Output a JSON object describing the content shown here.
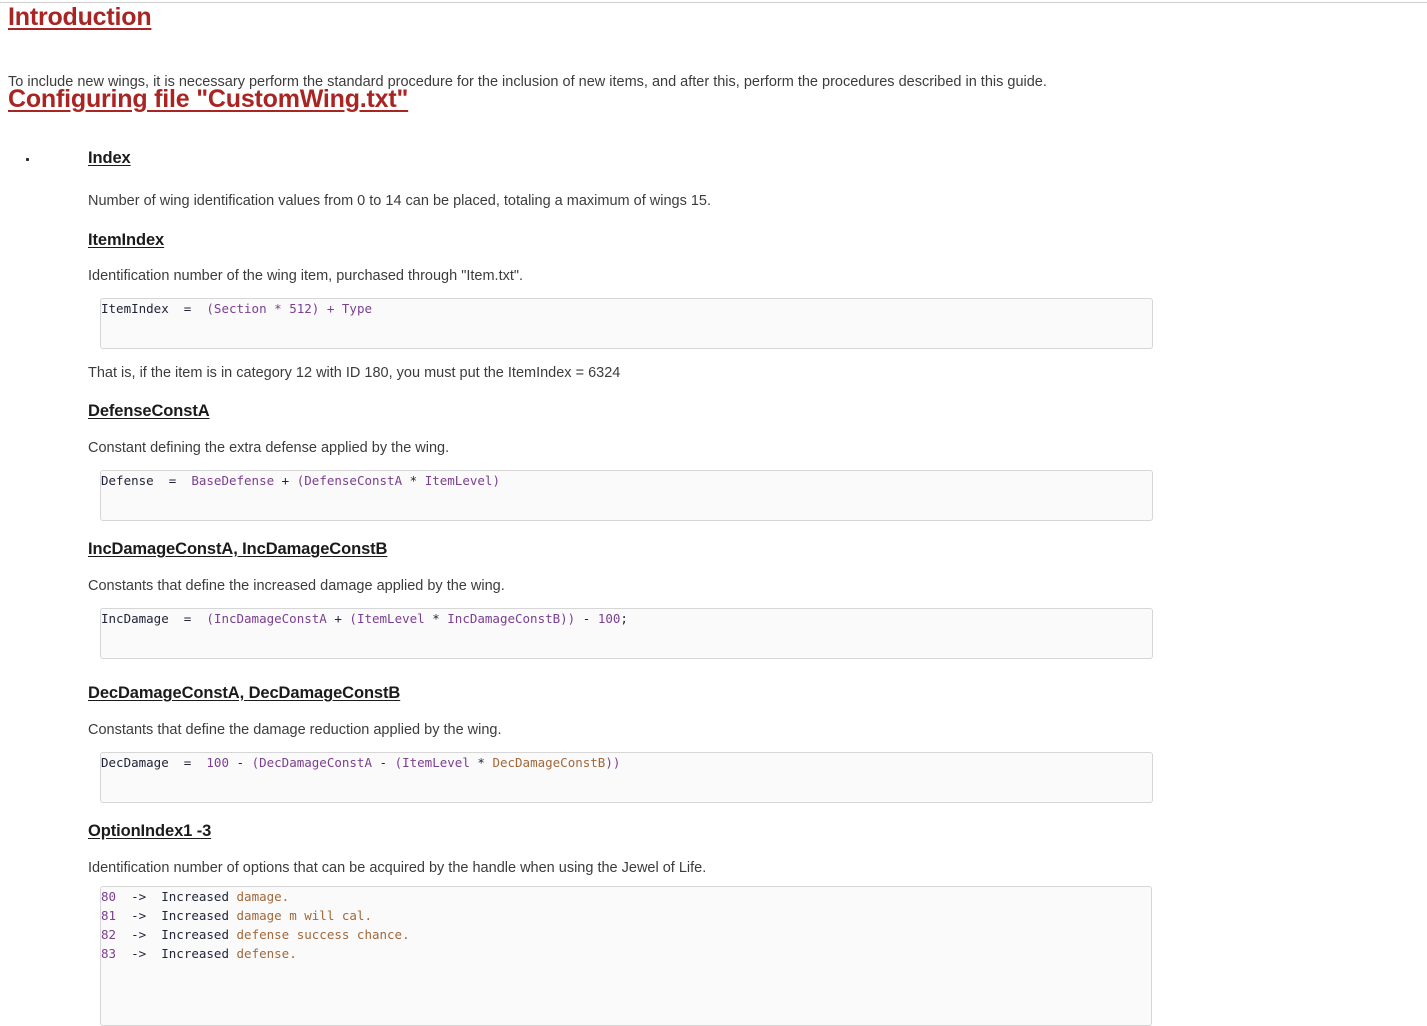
{
  "document": {
    "title_1": "Introduction",
    "intro_paragraph": "To include new wings, it is necessary perform the standard procedure for the inclusion of new items, and after this, perform the procedures described in this guide.",
    "title_2": "Configuring file \"CustomWing.txt\""
  },
  "sections": [
    {
      "heading": "Index",
      "description": "Number of wing identification values from 0 to 14 can be placed, totaling a maximum of wings 15."
    },
    {
      "heading": "ItemIndex",
      "description": "Identification number of the wing item, purchased through \"Item.txt\".",
      "code": {
        "lhs": "ItemIndex",
        "eq": "=",
        "open": "(",
        "arg1": "Section",
        "mul": "*",
        "num": "512",
        "close": ")",
        "plus": "+",
        "arg2": "Type"
      },
      "note": "That is, if the item is in category 12 with ID 180, you must put the ItemIndex = 6324"
    },
    {
      "heading": "DefenseConstA",
      "description": "Constant defining the extra defense applied by the wing.",
      "code": {
        "lhs": "Defense",
        "eq": "=",
        "base": "BaseDefense",
        "plus": "+",
        "open": "(",
        "arg1": "DefenseConstA",
        "mul": "*",
        "arg2": "ItemLevel",
        "close": ")"
      }
    },
    {
      "heading": "IncDamageConstA, IncDamageConstB",
      "description": "Constants that define the increased damage applied by the wing.",
      "code": {
        "lhs": "IncDamage",
        "eq": "=",
        "open1": "(",
        "arg1": "IncDamageConstA",
        "plus": "+",
        "open2": "(",
        "arg2": "ItemLevel",
        "mul": "*",
        "arg3": "IncDamageConstB",
        "close": "))",
        "minus": "-",
        "num": "100",
        "semi": ";"
      }
    },
    {
      "heading": "DecDamageConstA, DecDamageConstB",
      "description": "Constants that define the damage reduction applied by the wing.",
      "code": {
        "lhs": "DecDamage",
        "eq": "=",
        "num": "100",
        "minus1": "-",
        "open1": "(",
        "arg1": "DecDamageConstA",
        "minus2": "-",
        "open2": "(",
        "arg2": "ItemLevel",
        "mul": "*",
        "arg3": "DecDamageConstB",
        "close": "))"
      }
    },
    {
      "heading": "OptionIndex1 -3",
      "description": "Identification number of options that can be acquired by the handle when using the Jewel of Life.",
      "option_lines": [
        {
          "code": "80",
          "arrow": "->",
          "verb": "Increased",
          "rest": "damage."
        },
        {
          "code": "81",
          "arrow": "->",
          "verb": "Increased",
          "rest": "damage m will cal."
        },
        {
          "code": "82",
          "arrow": "->",
          "verb": "Increased",
          "rest": "defense success chance."
        },
        {
          "code": "83",
          "arrow": "->",
          "verb": "Increased",
          "rest": "defense."
        }
      ]
    }
  ],
  "colors": {
    "heading_red": "#a92523",
    "body_text": "#3c3c3c",
    "section_heading": "#1b1b1b",
    "code_bg": "#fafafa",
    "code_border": "#d6d6d6",
    "token_plain": "#22243a",
    "token_name": "#7a3f8f",
    "token_word": "#a2683a"
  }
}
